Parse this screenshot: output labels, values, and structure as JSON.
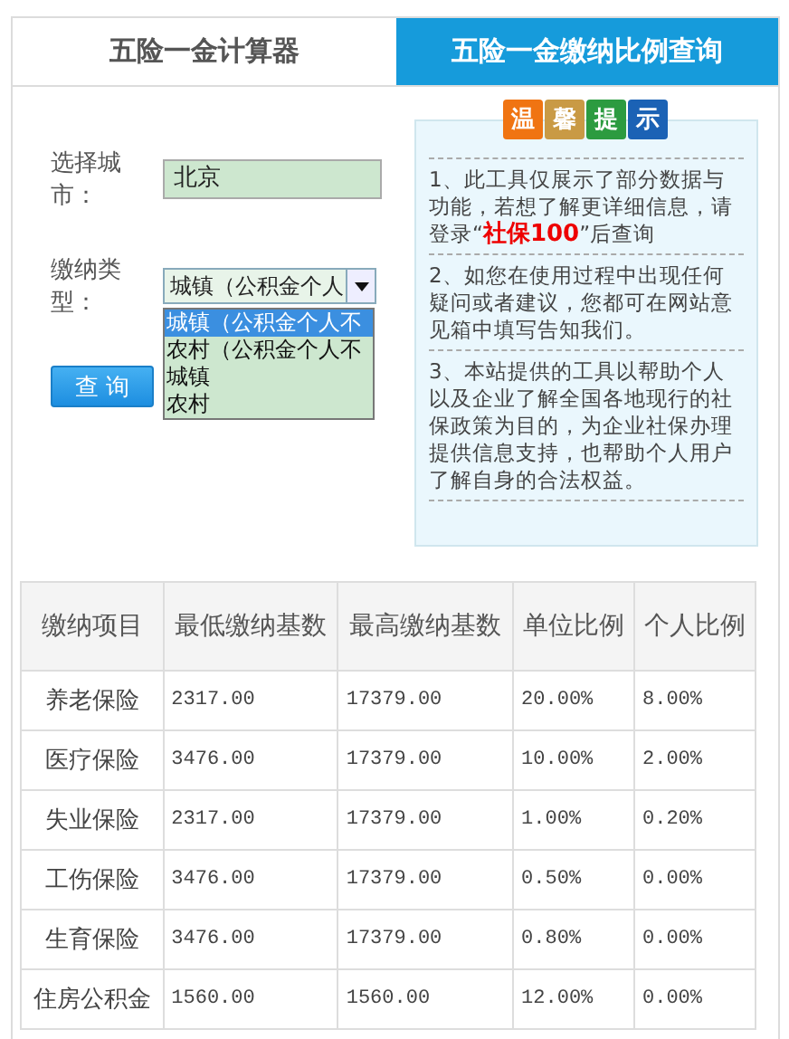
{
  "tabs": [
    {
      "label": "五险一金计算器",
      "selected": false
    },
    {
      "label": "五险一金缴纳比例查询",
      "selected": true
    }
  ],
  "form": {
    "city_label": "选择城市：",
    "city_value": "北京",
    "type_label": "缴纳类型：",
    "type_value": "城镇（公积金个人",
    "query_button": "查 询",
    "options": [
      {
        "label": "城镇（公积金个人不",
        "selected": true
      },
      {
        "label": "农村（公积金个人不",
        "selected": false
      },
      {
        "label": "城镇",
        "selected": false
      },
      {
        "label": "农村",
        "selected": false
      }
    ]
  },
  "tip": {
    "badges": [
      {
        "char": "温",
        "color": "#f07412"
      },
      {
        "char": "馨",
        "color": "#c99a45"
      },
      {
        "char": "提",
        "color": "#2c9b40"
      },
      {
        "char": "示",
        "color": "#1b62b5"
      }
    ],
    "items": [
      "1、此工具仅展示了部分数据与功能，若想了解更详细信息，请登录“**社保100**”后查询",
      "2、如您在使用过程中出现任何疑问或者建议，您都可在网站意见箱中填写告知我们。",
      "3、本站提供的工具以帮助个人以及企业了解全国各地现行的社保政策为目的，为企业社保办理提供信息支持，也帮助个人用户了解自身的合法权益。"
    ]
  },
  "table": {
    "columns": [
      "缴纳项目",
      "最低缴纳基数",
      "最高缴纳基数",
      "单位比例",
      "个人比例"
    ],
    "rows": [
      [
        "养老保险",
        "2317.00",
        "17379.00",
        "20.00%",
        "8.00%"
      ],
      [
        "医疗保险",
        "3476.00",
        "17379.00",
        "10.00%",
        "2.00%"
      ],
      [
        "失业保险",
        "2317.00",
        "17379.00",
        "1.00%",
        "0.20%"
      ],
      [
        "工伤保险",
        "3476.00",
        "17379.00",
        "0.50%",
        "0.00%"
      ],
      [
        "生育保险",
        "3476.00",
        "17379.00",
        "0.80%",
        "0.00%"
      ],
      [
        "住房公积金",
        "1560.00",
        "1560.00",
        "12.00%",
        "0.00%"
      ]
    ]
  }
}
